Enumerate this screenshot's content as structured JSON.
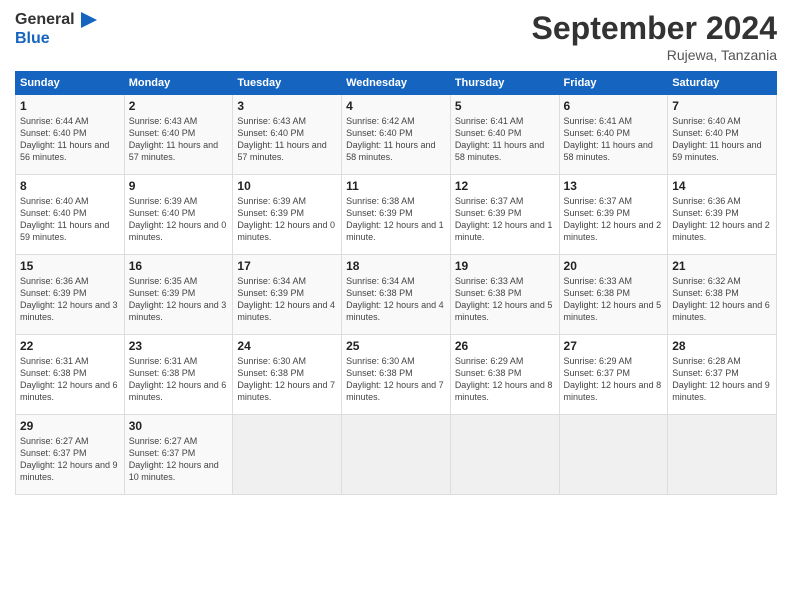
{
  "header": {
    "logo_line1": "General",
    "logo_line2": "Blue",
    "month": "September 2024",
    "location": "Rujewa, Tanzania"
  },
  "columns": [
    "Sunday",
    "Monday",
    "Tuesday",
    "Wednesday",
    "Thursday",
    "Friday",
    "Saturday"
  ],
  "weeks": [
    [
      {
        "day": "1",
        "sunrise": "6:44 AM",
        "sunset": "6:40 PM",
        "daylight": "11 hours and 56 minutes."
      },
      {
        "day": "2",
        "sunrise": "6:43 AM",
        "sunset": "6:40 PM",
        "daylight": "11 hours and 57 minutes."
      },
      {
        "day": "3",
        "sunrise": "6:43 AM",
        "sunset": "6:40 PM",
        "daylight": "11 hours and 57 minutes."
      },
      {
        "day": "4",
        "sunrise": "6:42 AM",
        "sunset": "6:40 PM",
        "daylight": "11 hours and 58 minutes."
      },
      {
        "day": "5",
        "sunrise": "6:41 AM",
        "sunset": "6:40 PM",
        "daylight": "11 hours and 58 minutes."
      },
      {
        "day": "6",
        "sunrise": "6:41 AM",
        "sunset": "6:40 PM",
        "daylight": "11 hours and 58 minutes."
      },
      {
        "day": "7",
        "sunrise": "6:40 AM",
        "sunset": "6:40 PM",
        "daylight": "11 hours and 59 minutes."
      }
    ],
    [
      {
        "day": "8",
        "sunrise": "6:40 AM",
        "sunset": "6:40 PM",
        "daylight": "11 hours and 59 minutes."
      },
      {
        "day": "9",
        "sunrise": "6:39 AM",
        "sunset": "6:40 PM",
        "daylight": "12 hours and 0 minutes."
      },
      {
        "day": "10",
        "sunrise": "6:39 AM",
        "sunset": "6:39 PM",
        "daylight": "12 hours and 0 minutes."
      },
      {
        "day": "11",
        "sunrise": "6:38 AM",
        "sunset": "6:39 PM",
        "daylight": "12 hours and 1 minute."
      },
      {
        "day": "12",
        "sunrise": "6:37 AM",
        "sunset": "6:39 PM",
        "daylight": "12 hours and 1 minute."
      },
      {
        "day": "13",
        "sunrise": "6:37 AM",
        "sunset": "6:39 PM",
        "daylight": "12 hours and 2 minutes."
      },
      {
        "day": "14",
        "sunrise": "6:36 AM",
        "sunset": "6:39 PM",
        "daylight": "12 hours and 2 minutes."
      }
    ],
    [
      {
        "day": "15",
        "sunrise": "6:36 AM",
        "sunset": "6:39 PM",
        "daylight": "12 hours and 3 minutes."
      },
      {
        "day": "16",
        "sunrise": "6:35 AM",
        "sunset": "6:39 PM",
        "daylight": "12 hours and 3 minutes."
      },
      {
        "day": "17",
        "sunrise": "6:34 AM",
        "sunset": "6:39 PM",
        "daylight": "12 hours and 4 minutes."
      },
      {
        "day": "18",
        "sunrise": "6:34 AM",
        "sunset": "6:38 PM",
        "daylight": "12 hours and 4 minutes."
      },
      {
        "day": "19",
        "sunrise": "6:33 AM",
        "sunset": "6:38 PM",
        "daylight": "12 hours and 5 minutes."
      },
      {
        "day": "20",
        "sunrise": "6:33 AM",
        "sunset": "6:38 PM",
        "daylight": "12 hours and 5 minutes."
      },
      {
        "day": "21",
        "sunrise": "6:32 AM",
        "sunset": "6:38 PM",
        "daylight": "12 hours and 6 minutes."
      }
    ],
    [
      {
        "day": "22",
        "sunrise": "6:31 AM",
        "sunset": "6:38 PM",
        "daylight": "12 hours and 6 minutes."
      },
      {
        "day": "23",
        "sunrise": "6:31 AM",
        "sunset": "6:38 PM",
        "daylight": "12 hours and 6 minutes."
      },
      {
        "day": "24",
        "sunrise": "6:30 AM",
        "sunset": "6:38 PM",
        "daylight": "12 hours and 7 minutes."
      },
      {
        "day": "25",
        "sunrise": "6:30 AM",
        "sunset": "6:38 PM",
        "daylight": "12 hours and 7 minutes."
      },
      {
        "day": "26",
        "sunrise": "6:29 AM",
        "sunset": "6:38 PM",
        "daylight": "12 hours and 8 minutes."
      },
      {
        "day": "27",
        "sunrise": "6:29 AM",
        "sunset": "6:37 PM",
        "daylight": "12 hours and 8 minutes."
      },
      {
        "day": "28",
        "sunrise": "6:28 AM",
        "sunset": "6:37 PM",
        "daylight": "12 hours and 9 minutes."
      }
    ],
    [
      {
        "day": "29",
        "sunrise": "6:27 AM",
        "sunset": "6:37 PM",
        "daylight": "12 hours and 9 minutes."
      },
      {
        "day": "30",
        "sunrise": "6:27 AM",
        "sunset": "6:37 PM",
        "daylight": "12 hours and 10 minutes."
      },
      null,
      null,
      null,
      null,
      null
    ]
  ]
}
